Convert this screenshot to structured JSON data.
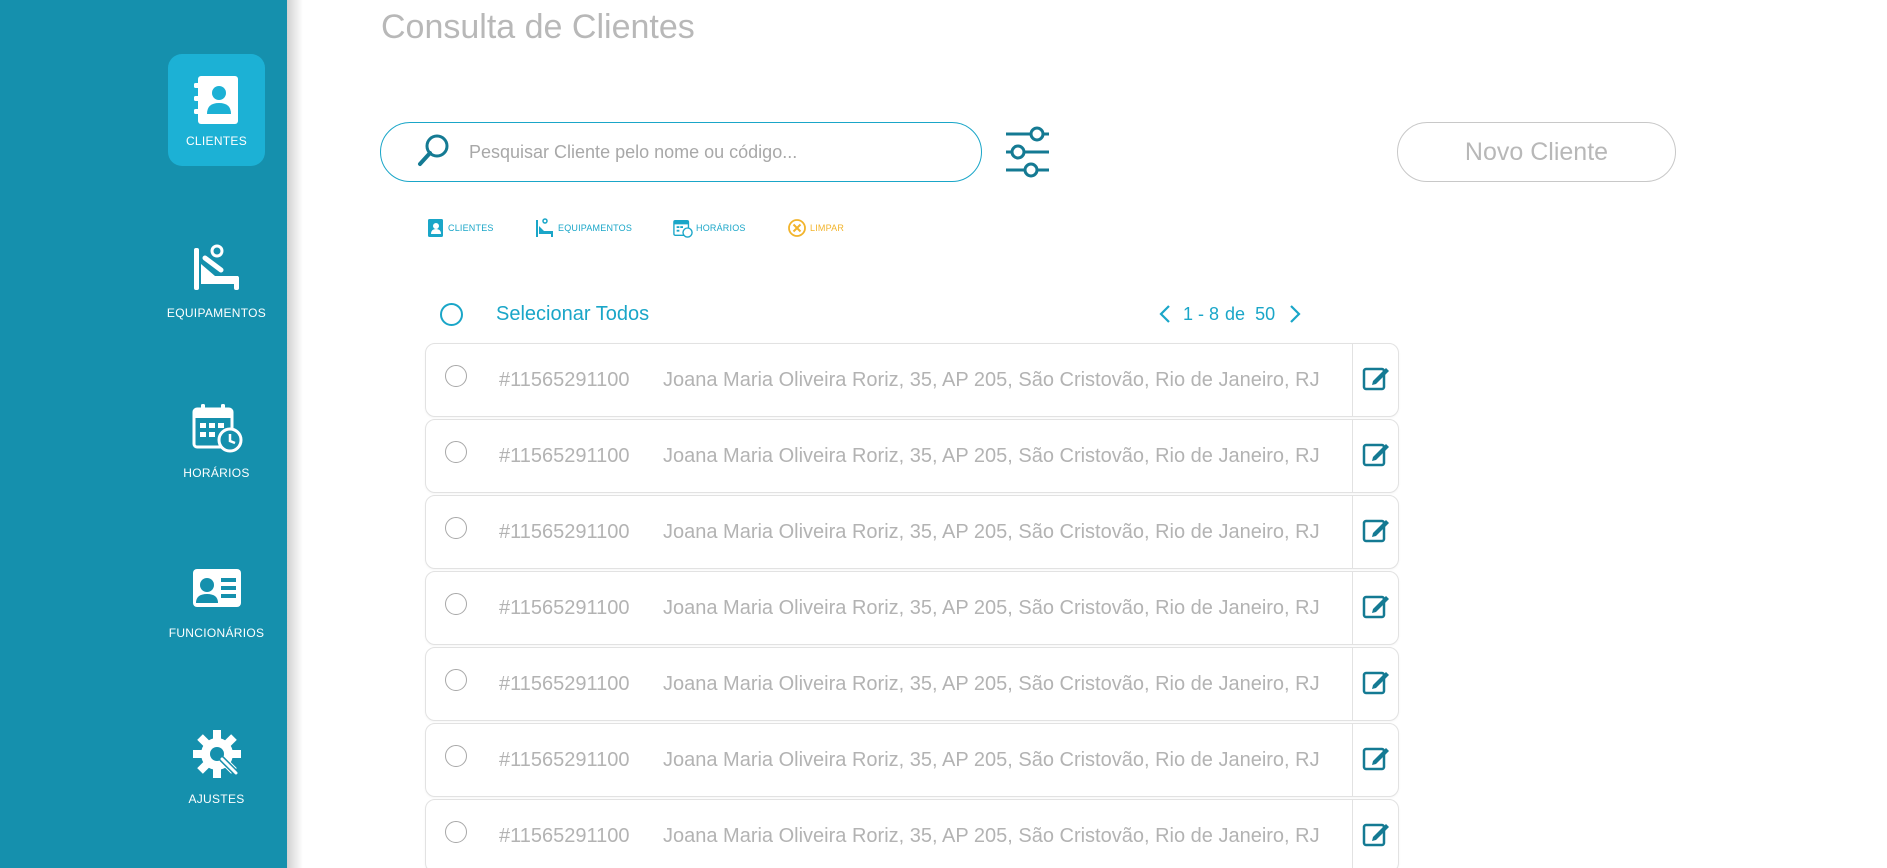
{
  "colors": {
    "sidebar_bg": "#1590ad",
    "sidebar_active": "#1cb1d5",
    "accent": "#1aa6c8",
    "dark_accent": "#147a93",
    "warning": "#f2b42c",
    "muted_text": "#b3b3b3"
  },
  "sidebar": {
    "items": [
      {
        "label": "CLIENTES",
        "icon": "contact-book-icon",
        "active": true
      },
      {
        "label": "EQUIPAMENTOS",
        "icon": "patient-bed-icon",
        "active": false
      },
      {
        "label": "HORÁRIOS",
        "icon": "calendar-clock-icon",
        "active": false
      },
      {
        "label": "FUNCIONÁRIOS",
        "icon": "id-card-icon",
        "active": false
      },
      {
        "label": "AJUSTES",
        "icon": "gear-wrench-icon",
        "active": false
      }
    ]
  },
  "page": {
    "title": "Consulta de Clientes"
  },
  "search": {
    "placeholder": "Pesquisar Cliente pelo nome ou código...",
    "value": ""
  },
  "toolbar": {
    "new_client_label": "Novo Cliente"
  },
  "filters": [
    {
      "label": "CLIENTES",
      "icon": "contact-book-icon"
    },
    {
      "label": "EQUIPAMENTOS",
      "icon": "patient-bed-icon"
    },
    {
      "label": "HORÁRIOS",
      "icon": "calendar-clock-icon"
    },
    {
      "label": "LIMPAR",
      "icon": "clear-circle-icon"
    }
  ],
  "list": {
    "select_all_label": "Selecionar Todos",
    "pagination": {
      "range": "1 - 8",
      "of_label": "de",
      "total": "50"
    },
    "rows": [
      {
        "code": "#11565291100",
        "description": "Joana Maria Oliveira Roriz, 35, AP 205, São Cristovão, Rio de Janeiro, RJ"
      },
      {
        "code": "#11565291100",
        "description": "Joana Maria Oliveira Roriz, 35, AP 205, São Cristovão, Rio de Janeiro, RJ"
      },
      {
        "code": "#11565291100",
        "description": "Joana Maria Oliveira Roriz, 35, AP 205, São Cristovão, Rio de Janeiro, RJ"
      },
      {
        "code": "#11565291100",
        "description": "Joana Maria Oliveira Roriz, 35, AP 205, São Cristovão, Rio de Janeiro, RJ"
      },
      {
        "code": "#11565291100",
        "description": "Joana Maria Oliveira Roriz, 35, AP 205, São Cristovão, Rio de Janeiro, RJ"
      },
      {
        "code": "#11565291100",
        "description": "Joana Maria Oliveira Roriz, 35, AP 205, São Cristovão, Rio de Janeiro, RJ"
      },
      {
        "code": "#11565291100",
        "description": "Joana Maria Oliveira Roriz, 35, AP 205, São Cristovão, Rio de Janeiro, RJ"
      }
    ]
  }
}
